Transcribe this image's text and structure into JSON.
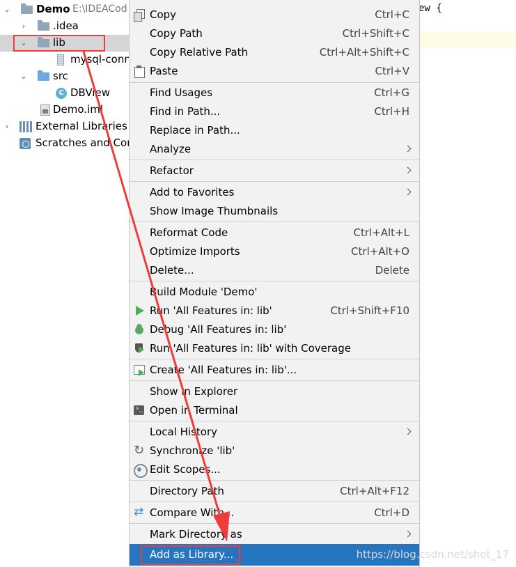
{
  "tree": {
    "root": {
      "name": "Demo",
      "path": "E:\\IDEACod"
    },
    "items": [
      {
        "label": ".idea"
      },
      {
        "label": "lib"
      },
      {
        "label": "mysql-conn"
      },
      {
        "label": "src"
      },
      {
        "label": "DBView"
      },
      {
        "label": "Demo.iml"
      },
      {
        "label": "External Libraries"
      },
      {
        "label": "Scratches and Con"
      }
    ]
  },
  "editor": {
    "code": "ew {"
  },
  "menu": {
    "items": [
      {
        "label": "Copy",
        "shortcut": "Ctrl+C"
      },
      {
        "label": "Copy Path",
        "shortcut": "Ctrl+Shift+C"
      },
      {
        "label": "Copy Relative Path",
        "shortcut": "Ctrl+Alt+Shift+C"
      },
      {
        "label": "Paste",
        "shortcut": "Ctrl+V"
      },
      {
        "label": "Find Usages",
        "shortcut": "Ctrl+G"
      },
      {
        "label": "Find in Path...",
        "shortcut": "Ctrl+H"
      },
      {
        "label": "Replace in Path..."
      },
      {
        "label": "Analyze"
      },
      {
        "label": "Refactor"
      },
      {
        "label": "Add to Favorites"
      },
      {
        "label": "Show Image Thumbnails"
      },
      {
        "label": "Reformat Code",
        "shortcut": "Ctrl+Alt+L"
      },
      {
        "label": "Optimize Imports",
        "shortcut": "Ctrl+Alt+O"
      },
      {
        "label": "Delete...",
        "shortcut": "Delete"
      },
      {
        "label": "Build Module 'Demo'"
      },
      {
        "label": "Run 'All Features in: lib'",
        "shortcut": "Ctrl+Shift+F10"
      },
      {
        "label": "Debug 'All Features in: lib'"
      },
      {
        "label": "Run 'All Features in: lib' with Coverage"
      },
      {
        "label": "Create 'All Features in: lib'..."
      },
      {
        "label": "Show in Explorer"
      },
      {
        "label": "Open in Terminal"
      },
      {
        "label": "Local History"
      },
      {
        "label": "Synchronize 'lib'"
      },
      {
        "label": "Edit Scopes..."
      },
      {
        "label": "Directory Path",
        "shortcut": "Ctrl+Alt+F12"
      },
      {
        "label": "Compare With...",
        "shortcut": "Ctrl+D"
      },
      {
        "label": "Mark Directory as"
      },
      {
        "label": "Add as Library..."
      }
    ]
  },
  "watermark": "https://blog.csdn.net/shot_17",
  "colors": {
    "highlight": "#2675bf",
    "annotation": "#ef3b3b",
    "selection": "#d5d5d5"
  }
}
